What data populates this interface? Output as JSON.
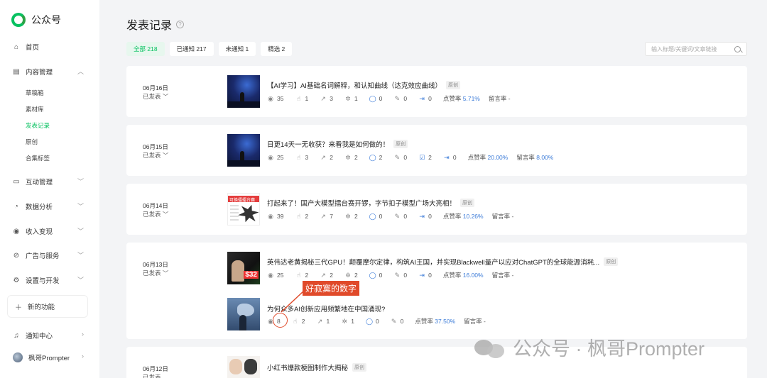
{
  "app": {
    "name": "公众号"
  },
  "sidebar": {
    "home": "首页",
    "content": "内容管理",
    "content_sub": [
      "草稿箱",
      "素材库",
      "发表记录",
      "原创",
      "合集标签"
    ],
    "interaction": "互动管理",
    "analytics": "数据分析",
    "revenue": "收入变现",
    "ads": "广告与服务",
    "settings": "设置与开发",
    "new_features": "新的功能",
    "notifications": "通知中心",
    "account": "枫哥Prompter"
  },
  "page": {
    "title": "发表记录"
  },
  "tabs": [
    "全部 218",
    "已通知 217",
    "未通知 1",
    "精选 2"
  ],
  "search": {
    "placeholder": "输入标题/关键词/文章链接"
  },
  "labels": {
    "published": "已发表",
    "original": "原创",
    "like_rate": "点赞率",
    "harm_rate": "留言率"
  },
  "posts": [
    {
      "date": "06月16日",
      "articles": [
        {
          "title": "【AI学习】AI基础名词解释，和认知曲线（达克效应曲线）",
          "views": "35",
          "likes": "1",
          "shares": "3",
          "wow": "1",
          "comments": "0",
          "edits": "0",
          "extra": "0",
          "like_rate": "5.71%",
          "harm_rate": "-"
        }
      ]
    },
    {
      "date": "06月15日",
      "articles": [
        {
          "title": "日更14天一无收获？来看我是如何做的！",
          "views": "25",
          "likes": "3",
          "shares": "2",
          "wow": "2",
          "comments": "2",
          "edits": "0",
          "checked": "2",
          "extra": "0",
          "like_rate": "20.00%",
          "harm_rate": "8.00%"
        }
      ]
    },
    {
      "date": "06月14日",
      "articles": [
        {
          "title": "打起来了！国产大模型擂台赛开锣，字节扣子模型广场大亮相！",
          "thumb_text": "可换擂擂台赛",
          "views": "39",
          "likes": "2",
          "shares": "7",
          "wow": "2",
          "comments": "0",
          "edits": "0",
          "extra": "0",
          "like_rate": "10.26%",
          "harm_rate": "-"
        }
      ]
    },
    {
      "date": "06月13日",
      "articles": [
        {
          "title": "英伟达老黄揭秘三代GPU！颠覆摩尔定律，构筑AI王国，并实现Blackwell量产以应对ChatGPT的全球能源消耗...",
          "thumb_text": "$32",
          "views": "25",
          "likes": "2",
          "shares": "2",
          "wow": "2",
          "comments": "0",
          "edits": "0",
          "extra": "0",
          "like_rate": "16.00%",
          "harm_rate": "-"
        },
        {
          "title": "为何众多AI创新应用频繁地在中国涌现?",
          "views": "8",
          "likes": "2",
          "shares": "1",
          "wow": "1",
          "comments": "0",
          "edits": "0",
          "like_rate": "37.50%",
          "harm_rate": "-"
        }
      ]
    },
    {
      "date": "06月12日",
      "articles": [
        {
          "title": "小红书爆款梗图制作大揭秘"
        }
      ]
    }
  ],
  "annotation": {
    "text": "好寂寞的数字",
    "color": "#e04a2a"
  },
  "watermark": {
    "text": "公众号 · 枫哥Prompter"
  },
  "colors": {
    "accent": "#07c160",
    "link": "#3b7bd8"
  }
}
